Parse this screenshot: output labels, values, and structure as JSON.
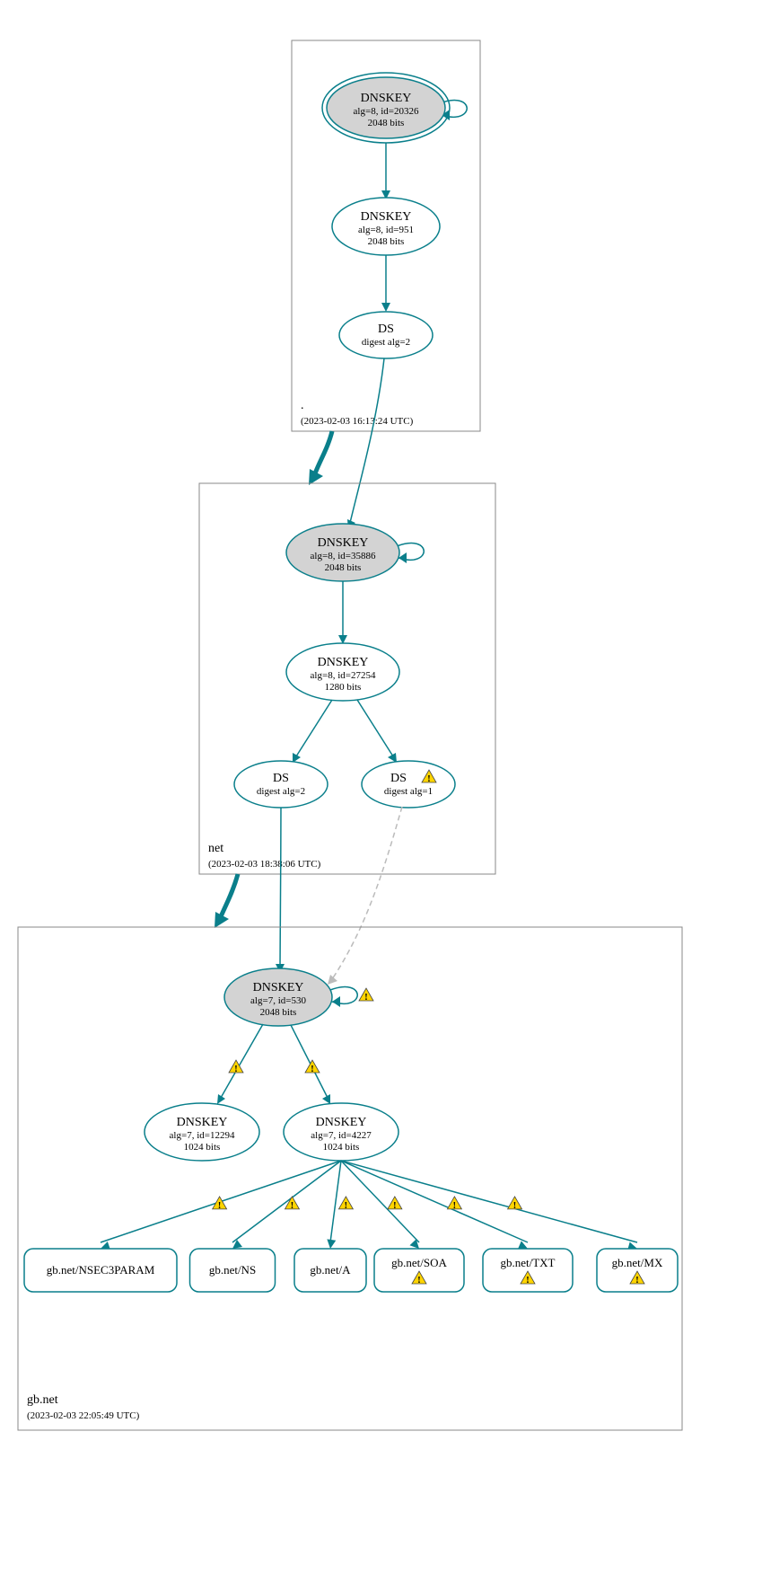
{
  "zones": {
    "root": {
      "label": ".",
      "timestamp": "(2023-02-03 16:13:24 UTC)",
      "nodes": {
        "ksk": {
          "title": "DNSKEY",
          "line1": "alg=8, id=20326",
          "line2": "2048 bits",
          "double": true,
          "grey": true
        },
        "zsk": {
          "title": "DNSKEY",
          "line1": "alg=8, id=951",
          "line2": "2048 bits"
        },
        "ds": {
          "title": "DS",
          "line1": "digest alg=2"
        }
      }
    },
    "net": {
      "label": "net",
      "timestamp": "(2023-02-03 18:38:06 UTC)",
      "nodes": {
        "ksk": {
          "title": "DNSKEY",
          "line1": "alg=8, id=35886",
          "line2": "2048 bits",
          "grey": true
        },
        "zsk": {
          "title": "DNSKEY",
          "line1": "alg=8, id=27254",
          "line2": "1280 bits"
        },
        "ds1": {
          "title": "DS",
          "line1": "digest alg=2"
        },
        "ds2": {
          "title": "DS",
          "line1": "digest alg=1",
          "warn": true
        }
      }
    },
    "gbnet": {
      "label": "gb.net",
      "timestamp": "(2023-02-03 22:05:49 UTC)",
      "nodes": {
        "ksk": {
          "title": "DNSKEY",
          "line1": "alg=7, id=530",
          "line2": "2048 bits",
          "grey": true,
          "self_warn": true
        },
        "zsk1": {
          "title": "DNSKEY",
          "line1": "alg=7, id=12294",
          "line2": "1024 bits"
        },
        "zsk2": {
          "title": "DNSKEY",
          "line1": "alg=7, id=4227",
          "line2": "1024 bits"
        }
      },
      "rrsets": [
        {
          "label": "gb.net/NSEC3PARAM"
        },
        {
          "label": "gb.net/NS"
        },
        {
          "label": "gb.net/A"
        },
        {
          "label": "gb.net/SOA",
          "warn": true
        },
        {
          "label": "gb.net/TXT",
          "warn": true
        },
        {
          "label": "gb.net/MX",
          "warn": true
        }
      ]
    }
  },
  "edge_warnings": {
    "ksk_to_zsk1": true,
    "ksk_to_zsk2": true,
    "zsk2_to_rr0": true,
    "zsk2_to_rr1": true,
    "zsk2_to_rr2": true,
    "zsk2_to_rr3": true,
    "zsk2_to_rr4": true,
    "zsk2_to_rr5": true
  }
}
